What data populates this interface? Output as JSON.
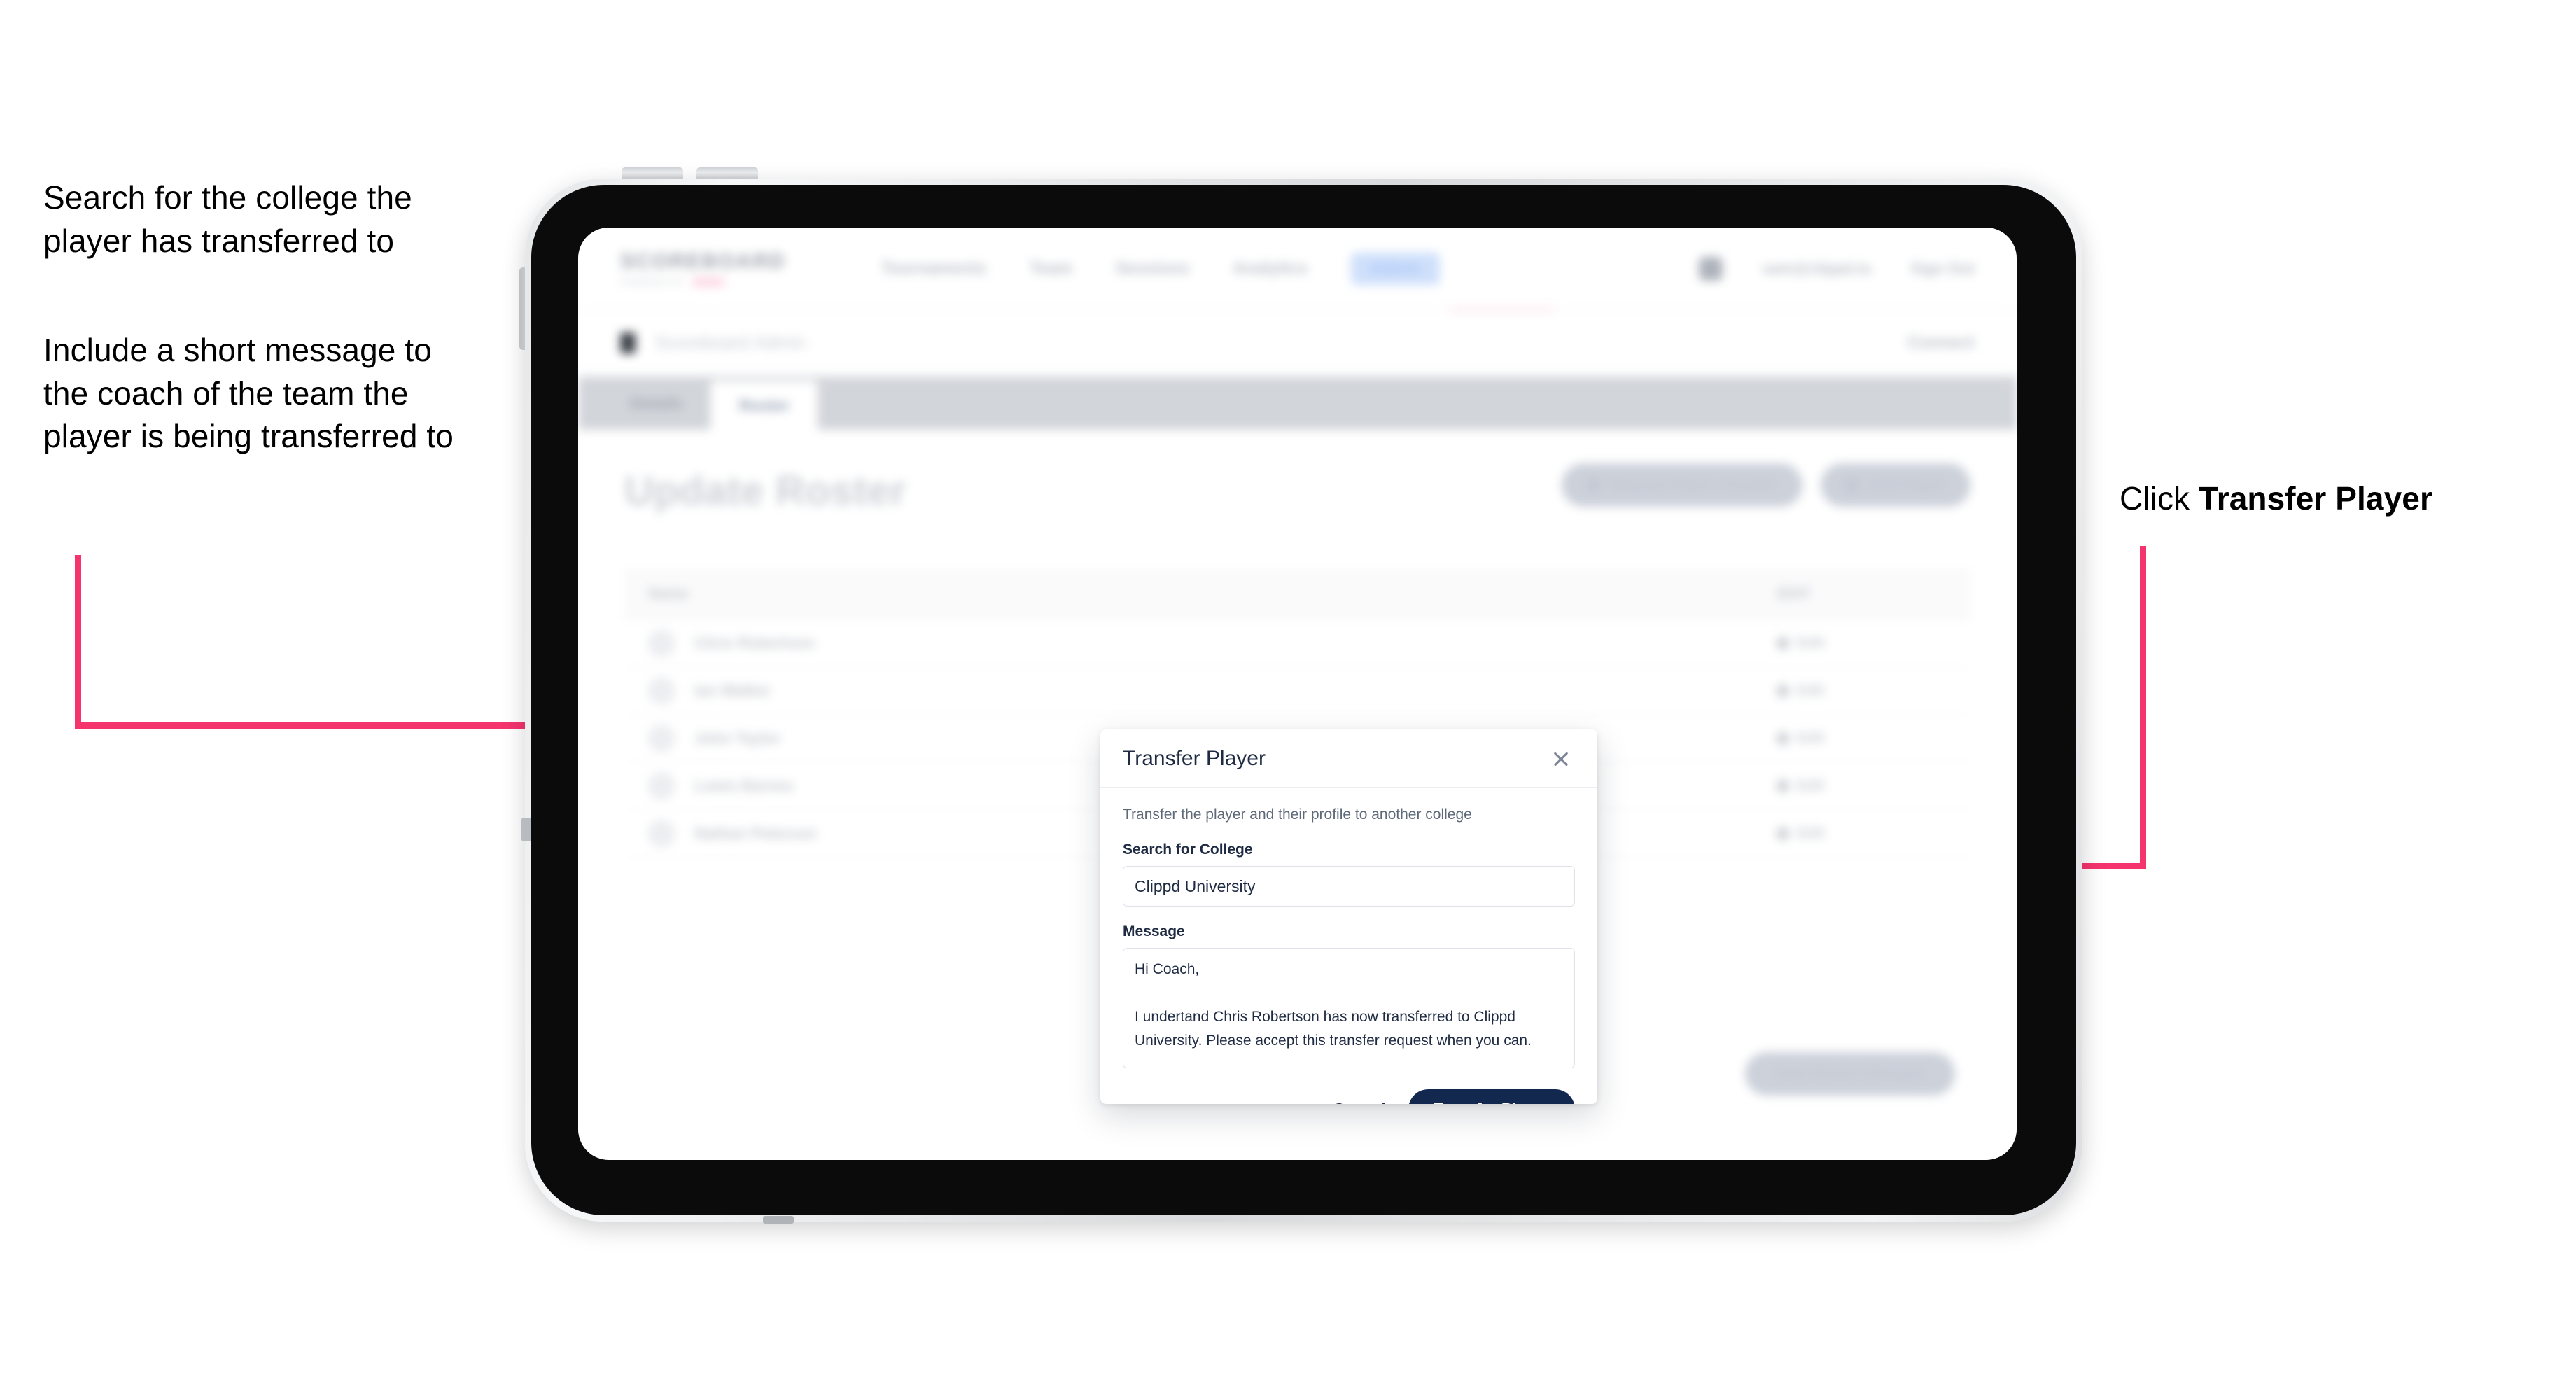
{
  "annotations": {
    "left_top": "Search for the college the player has transferred to",
    "left_bottom": "Include a short message to the coach of the team the player is being transferred to",
    "right_prefix": "Click ",
    "right_bold": "Transfer Player"
  },
  "app": {
    "logo": "SCOREBOARD",
    "logo_sub": "POWERED BY",
    "nav": [
      {
        "label": "Tournaments"
      },
      {
        "label": "Team"
      },
      {
        "label": "Sessions"
      },
      {
        "label": "Analytics"
      },
      {
        "label": "Admin"
      }
    ],
    "account": {
      "email": "sam@clippd.io",
      "signout": "Sign Out"
    },
    "subheader": {
      "title": "Scoreboard",
      "title_light": "Admin",
      "right": "Connect"
    },
    "tabs": [
      {
        "label": "Details",
        "selected": false
      },
      {
        "label": "Roster",
        "selected": true
      }
    ],
    "page_title": "Update Roster",
    "actions": [
      {
        "label": "Request Player Transfer",
        "icon": "transfer-icon"
      },
      {
        "label": "Add Player",
        "icon": "plus-icon"
      }
    ],
    "table": {
      "columns": [
        "Name",
        "EDIT"
      ],
      "rows": [
        {
          "name": "Chris Robertson",
          "action": "Edit"
        },
        {
          "name": "Ian Walker",
          "action": "Edit"
        },
        {
          "name": "John Taylor",
          "action": "Edit"
        },
        {
          "name": "Lewis Barnes",
          "action": "Edit"
        },
        {
          "name": "Nathan Peterson",
          "action": "Edit"
        }
      ]
    },
    "save_button": "Save Roster Changes"
  },
  "modal": {
    "title": "Transfer Player",
    "close_icon": "close-icon",
    "description": "Transfer the player and their profile to another college",
    "college_label": "Search for College",
    "college_value": "Clippd University",
    "college_placeholder": "Search for College",
    "message_label": "Message",
    "message_value": "Hi Coach,\n\nI undertand Chris Robertson has now transferred to Clippd University. Please accept this transfer request when you can.",
    "message_placeholder": "Message",
    "cancel_label": "Cancel",
    "submit_label": "Transfer Player"
  },
  "colors": {
    "accent_pink": "#f5346e",
    "navy": "#12284f",
    "text_dark": "#1f2b43"
  }
}
